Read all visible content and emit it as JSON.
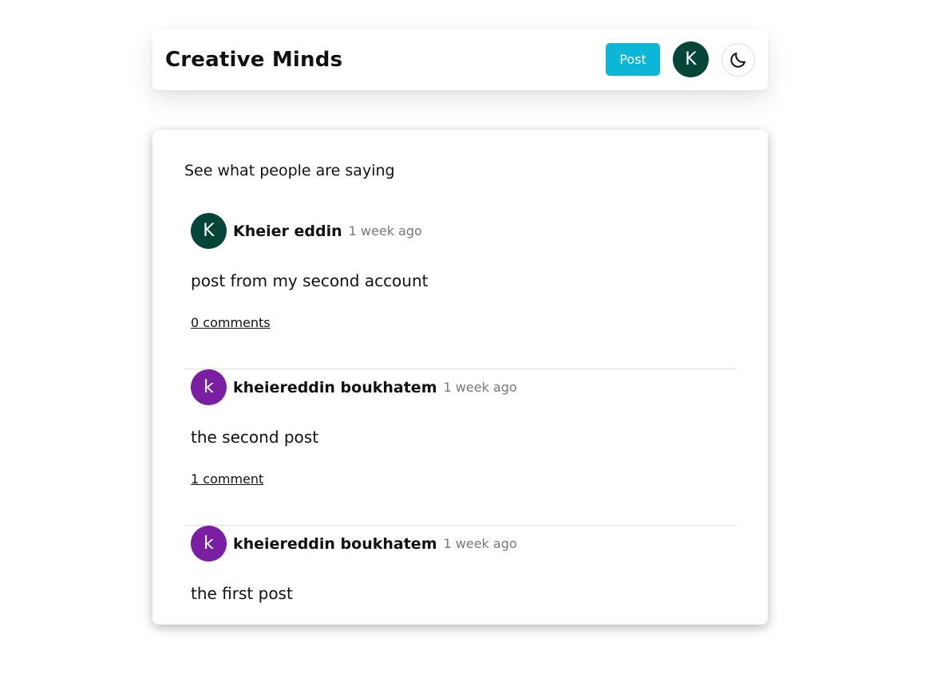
{
  "header": {
    "brand": "Creative Minds",
    "post_label": "Post",
    "user_initial": "K"
  },
  "feed": {
    "title": "See what people are saying",
    "posts": [
      {
        "initial": "K",
        "author": "Kheier eddin",
        "time": "1 week ago",
        "body": "post from my second account",
        "comments": "0 comments",
        "avatar_color": "#034537"
      },
      {
        "initial": "k",
        "author": "kheiereddin boukhatem",
        "time": "1 week ago",
        "body": "the second post",
        "comments": "1 comment",
        "avatar_color": "#7b1fa2"
      },
      {
        "initial": "k",
        "author": "kheiereddin boukhatem",
        "time": "1 week ago",
        "body": "the first post",
        "comments": "",
        "avatar_color": "#7b1fa2"
      }
    ]
  },
  "colors": {
    "accent": "#0bb6d6",
    "user_avatar": "#034537"
  },
  "icons": {
    "theme_toggle": "moon-icon"
  }
}
